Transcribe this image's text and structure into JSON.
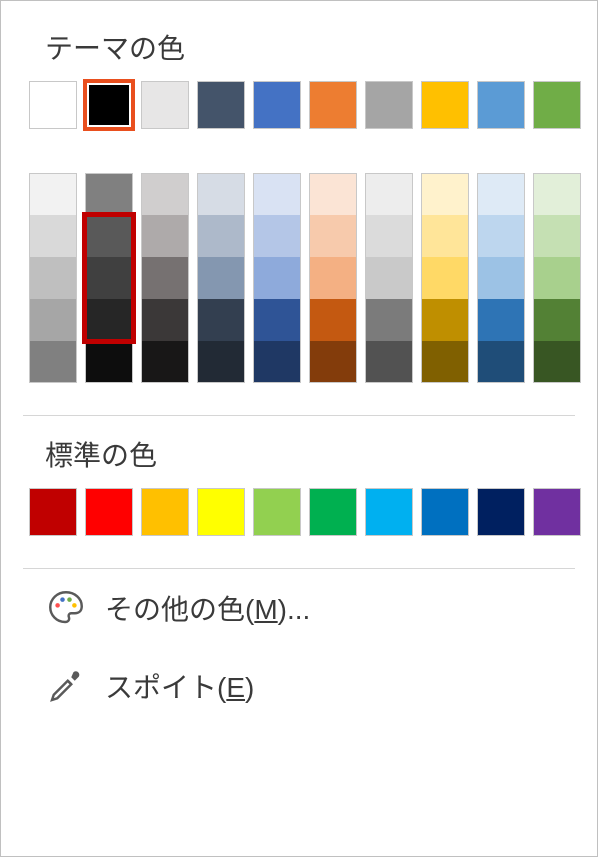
{
  "sections": {
    "theme_title": "テーマの色",
    "standard_title": "標準の色"
  },
  "theme_row": [
    {
      "name": "white",
      "hex": "#ffffff",
      "selected": false
    },
    {
      "name": "black",
      "hex": "#000000",
      "selected": true
    },
    {
      "name": "light-gray",
      "hex": "#e7e6e6",
      "selected": false
    },
    {
      "name": "dark-blue-gray",
      "hex": "#44546a",
      "selected": false
    },
    {
      "name": "blue",
      "hex": "#4472c4",
      "selected": false
    },
    {
      "name": "orange",
      "hex": "#ed7d31",
      "selected": false
    },
    {
      "name": "gray",
      "hex": "#a5a5a5",
      "selected": false
    },
    {
      "name": "gold",
      "hex": "#ffc000",
      "selected": false
    },
    {
      "name": "light-blue",
      "hex": "#5b9bd5",
      "selected": false
    },
    {
      "name": "green",
      "hex": "#70ad47",
      "selected": false
    }
  ],
  "theme_shades": [
    [
      "#f2f2f2",
      "#d9d9d9",
      "#bfbfbf",
      "#a6a6a6",
      "#808080"
    ],
    [
      "#808080",
      "#595959",
      "#404040",
      "#262626",
      "#0d0d0d"
    ],
    [
      "#d0cece",
      "#aeaaaa",
      "#767171",
      "#3b3838",
      "#181717"
    ],
    [
      "#d6dce5",
      "#adb9ca",
      "#8497b0",
      "#333f50",
      "#222a35"
    ],
    [
      "#d9e2f3",
      "#b4c6e7",
      "#8eaadb",
      "#2f5496",
      "#1f3864"
    ],
    [
      "#fbe4d5",
      "#f7caac",
      "#f4b083",
      "#c45911",
      "#833c0b"
    ],
    [
      "#ededed",
      "#dbdbdb",
      "#c9c9c9",
      "#7b7b7b",
      "#525252"
    ],
    [
      "#fff2cc",
      "#ffe599",
      "#ffd966",
      "#bf8f00",
      "#806000"
    ],
    [
      "#deeaf6",
      "#bdd6ee",
      "#9cc2e5",
      "#2e74b5",
      "#1f4d78"
    ],
    [
      "#e2efd9",
      "#c5e0b3",
      "#a8d08d",
      "#538135",
      "#385623"
    ]
  ],
  "shade_highlight_col": 1,
  "standard_row": [
    {
      "name": "dark-red",
      "hex": "#c00000"
    },
    {
      "name": "red",
      "hex": "#ff0000"
    },
    {
      "name": "orange",
      "hex": "#ffc000"
    },
    {
      "name": "yellow",
      "hex": "#ffff00"
    },
    {
      "name": "light-green",
      "hex": "#92d050"
    },
    {
      "name": "green",
      "hex": "#00b050"
    },
    {
      "name": "light-blue",
      "hex": "#00b0f0"
    },
    {
      "name": "blue",
      "hex": "#0070c0"
    },
    {
      "name": "dark-blue",
      "hex": "#002060"
    },
    {
      "name": "purple",
      "hex": "#7030a0"
    }
  ],
  "menu": {
    "more_colors_prefix": "その他の色(",
    "more_colors_mnemonic": "M",
    "more_colors_suffix": ")...",
    "eyedropper_prefix": "スポイト(",
    "eyedropper_mnemonic": "E",
    "eyedropper_suffix": ")"
  }
}
